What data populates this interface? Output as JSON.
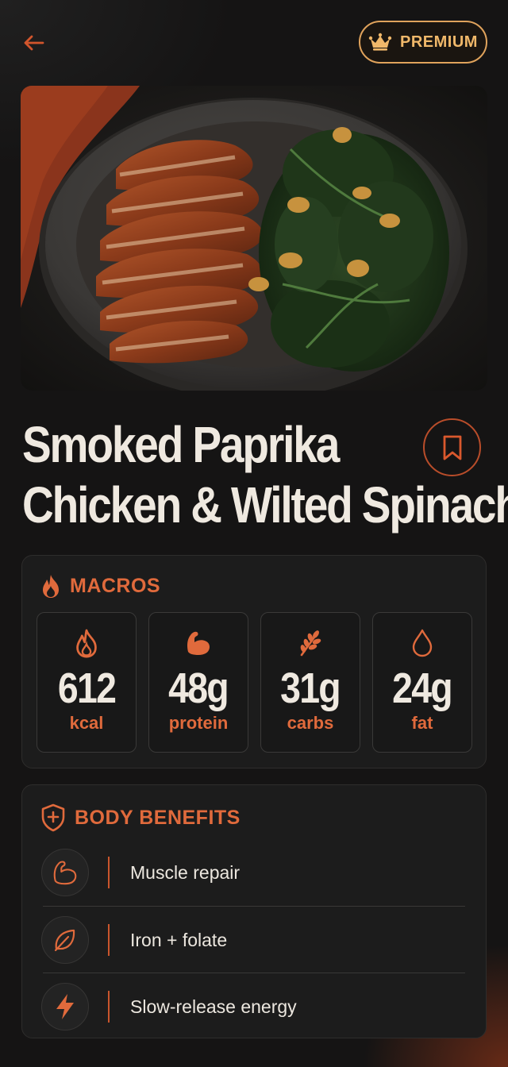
{
  "header": {
    "back_icon": "arrow-left-icon",
    "premium_icon": "crown-icon",
    "premium_label": "PREMIUM"
  },
  "hero": {
    "image": "plate of sliced smoked paprika chicken breast with wilted spinach and onions"
  },
  "recipe": {
    "title_line1": "Smoked Paprika",
    "title_line2": "Chicken & Wilted Spinach",
    "bookmark_icon": "bookmark-icon"
  },
  "macros": {
    "heading": "MACROS",
    "heading_icon": "flame-icon",
    "items": [
      {
        "value": "612",
        "unit": "kcal",
        "icon": "flame-icon"
      },
      {
        "value": "48g",
        "unit": "protein",
        "icon": "flexed-bicep-icon"
      },
      {
        "value": "31g",
        "unit": "carbs",
        "icon": "wheat-icon"
      },
      {
        "value": "24g",
        "unit": "fat",
        "icon": "droplet-icon"
      }
    ]
  },
  "benefits": {
    "heading": "BODY BENEFITS",
    "heading_icon": "shield-plus-icon",
    "items": [
      {
        "label": "Muscle repair",
        "icon": "flexed-bicep-icon"
      },
      {
        "label": "Iron + folate",
        "icon": "leaf-icon"
      },
      {
        "label": "Slow-release energy",
        "icon": "lightning-icon"
      }
    ]
  },
  "colors": {
    "accent": "#e06a3c",
    "premium": "#f0b86a",
    "background": "#151414",
    "card": "#1c1c1c"
  }
}
